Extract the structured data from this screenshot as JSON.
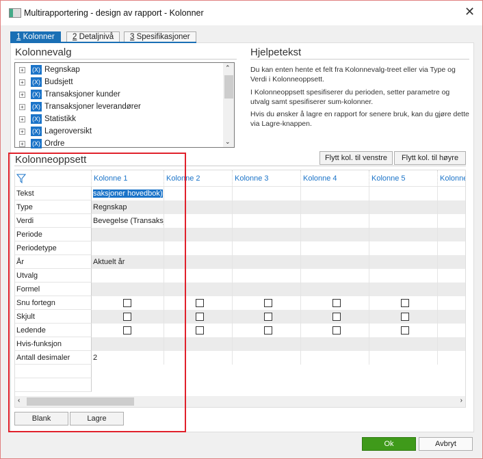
{
  "window": {
    "title": "Multirapportering - design av rapport - Kolonner",
    "close": "✕"
  },
  "tabs": [
    {
      "num": "1",
      "label": "Kolonner"
    },
    {
      "num": "2",
      "label": "Detaljnivå"
    },
    {
      "num": "3",
      "label": "Spesifikasjoner"
    }
  ],
  "kolonnevalg": {
    "title": "Kolonnevalg",
    "items": [
      "Regnskap",
      "Budsjett",
      "Transaksjoner kunder",
      "Transaksjoner leverandører",
      "Statistikk",
      "Lageroversikt",
      "Ordre"
    ],
    "icon_text": "(X)"
  },
  "hjelpetekst": {
    "title": "Hjelpetekst",
    "paragraphs": [
      "Du kan enten hente et felt fra Kolonnevalg-treet eller via Type og Verdi i Kolonneoppsett.",
      "I Kolonneoppsett spesifiserer du perioden, setter parametre og utvalg samt spesifiserer sum-kolonner.",
      "Hvis du ønsker å lagre en rapport for senere bruk, kan du gjøre dette via Lagre-knappen."
    ]
  },
  "move_buttons": {
    "left": "Flytt kol. til venstre",
    "right": "Flytt kol. til høyre"
  },
  "kolonneoppsett": {
    "title": "Kolonneoppsett",
    "columns": [
      "Kolonne 1",
      "Kolonne 2",
      "Kolonne 3",
      "Kolonne 4",
      "Kolonne 5",
      "Kolonne"
    ],
    "rows": [
      "Tekst",
      "Type",
      "Verdi",
      "Periode",
      "Periodetype",
      "År",
      "Utvalg",
      "Formel",
      "Snu fortegn",
      "Skjult",
      "Ledende",
      "Hvis-funksjon",
      "Antall desimaler",
      "",
      ""
    ],
    "col1_values": {
      "0": "saksjoner hovedbok)",
      "1": "Regnskap",
      "2": "Bevegelse (Transaksj",
      "5": "Aktuelt år",
      "12": "2"
    },
    "checkbox_rows": [
      8,
      9,
      10
    ]
  },
  "bottom_buttons": {
    "blank": "Blank",
    "lagre": "Lagre"
  },
  "dialog_buttons": {
    "ok": "Ok",
    "cancel": "Avbryt"
  },
  "colors": {
    "accent": "#1a6fb5",
    "ok": "#3f9a1a",
    "highlight": "#e0202a"
  }
}
